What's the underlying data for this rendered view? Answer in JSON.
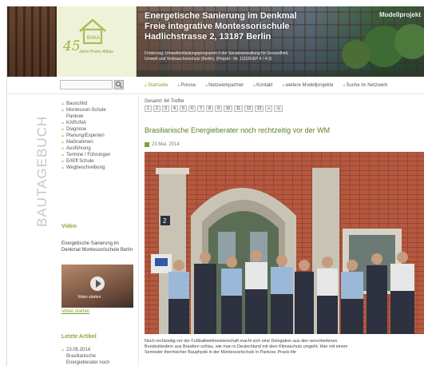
{
  "header": {
    "logo_number": "45",
    "logo_house_label": "BAKA",
    "logo_sub": "Jahre Praxis Altbau",
    "title_lines": [
      "Energetische Sanierung im Denkmal",
      "Freie integrative Montessorischule",
      "Hadlichstrasse 2, 13187 Berlin"
    ],
    "foerder_lines": [
      "Förderung: Umweltentlastungsprogramm II der Senatsverwaltung für Gesundheit,",
      "Umwelt und Verbraucherschutz (Berlin), (Projekt - Nr. 11118UEP II / 4-2)"
    ],
    "badge": "Modellprojekt"
  },
  "search": {
    "placeholder": ""
  },
  "nav": [
    {
      "label": "Startseite",
      "active": true
    },
    {
      "label": "Presse",
      "active": false
    },
    {
      "label": "Netzwerkpartner",
      "active": false
    },
    {
      "label": "Kontakt",
      "active": false
    },
    {
      "label": "weitere Modellprojekte",
      "active": false
    },
    {
      "label": "Suche im Netzwerk",
      "active": false
    }
  ],
  "sidebar": {
    "vertical_title": "BAUTAGEBUCH",
    "menu": [
      "Bauschild",
      "Montessori-Schule Pankow",
      "KARUNA",
      "Diagnose",
      "Planung/Experten",
      "Maßnahmen",
      "Ausführung",
      "Termine / Führungen",
      "ErlEff Schule",
      "Wegbeschreibung"
    ],
    "video_title": "Video",
    "video_text": "Energetische Sanierung im Denkmal Montessorischule Berlin",
    "video_overlay": "Video starten",
    "video_link": "Video starten",
    "latest_title": "Letzte Artikel",
    "latest_item_date": "23.05.2014",
    "latest_item_text": "Brasilianische Energieberater noch"
  },
  "main": {
    "gesamt": "Gesamt: 64 Treffer",
    "pages": [
      "1",
      "2",
      "3",
      "4",
      "5",
      "6",
      "7",
      "8",
      "9",
      "10",
      "11",
      "12",
      "13",
      "»",
      "»|"
    ],
    "title": "Brasilianische Energieberater noch rechtzeitig vor der WM",
    "date": "23.Mai. 2014",
    "house_number": "2",
    "text_lines": [
      "Noch rechtzeitig vor der Fußballweltmeisterschaft macht sich eine Delegation aus den verschiedenen",
      "Bundesländern aus Brasilien schlau, wie man in Deutschland mit dem Klimaschutz umgeht. Hier mit einem",
      "Semester thermischer Bauphysik in der Montessorischule in Pankow. Praxis life"
    ]
  },
  "colors": {
    "accent": "#7ea32a",
    "title_green": "#5b7e22",
    "brick": "#b3563f",
    "logo_bg": "#eef2d9"
  }
}
